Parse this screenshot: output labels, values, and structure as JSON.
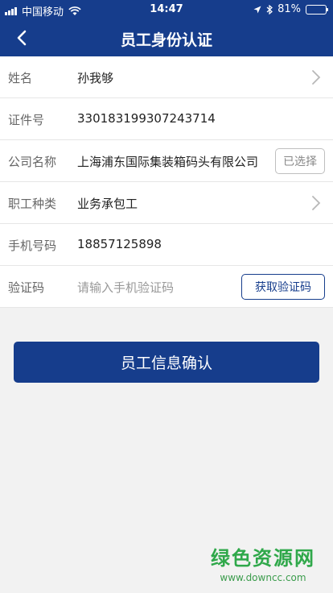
{
  "status_bar": {
    "carrier": "中国移动",
    "time": "14:47",
    "battery_percent": "81%",
    "battery_level": 0.81
  },
  "nav": {
    "title": "员工身份认证",
    "back_icon": "chevron-left-icon"
  },
  "form": {
    "rows": [
      {
        "label": "姓名",
        "value": "孙我够"
      },
      {
        "label": "证件号",
        "value": "330183199307243714"
      },
      {
        "label": "公司名称",
        "value": "上海浦东国际集装箱码头有限公司",
        "button": "已选择"
      },
      {
        "label": "职工种类",
        "value": "业务承包工"
      },
      {
        "label": "手机号码",
        "value": "18857125898"
      },
      {
        "label": "验证码",
        "placeholder": "请输入手机验证码",
        "button": "获取验证码"
      }
    ]
  },
  "confirm_button": "员工信息确认",
  "watermark": {
    "title": "绿色资源网",
    "url": "www.downcc.com"
  },
  "colors": {
    "primary": "#163d8c",
    "background": "#f2f2f2",
    "watermark_green": "#2fa84a"
  }
}
